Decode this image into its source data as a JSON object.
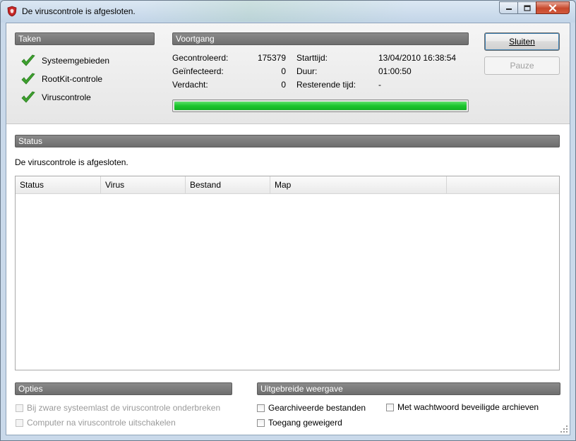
{
  "window": {
    "title": "De viruscontrole is afgesloten.",
    "icon": "shield-icon",
    "accent": "#c7492c"
  },
  "tasks": {
    "header": "Taken",
    "items": [
      {
        "label": "Systeemgebieden",
        "icon": "checkmark-icon"
      },
      {
        "label": "RootKit-controle",
        "icon": "checkmark-icon"
      },
      {
        "label": "Viruscontrole",
        "icon": "checkmark-icon"
      }
    ]
  },
  "progress": {
    "header": "Voortgang",
    "checked_label": "Gecontroleerd:",
    "checked_value": "175379",
    "infected_label": "Geïnfecteerd:",
    "infected_value": "0",
    "suspect_label": "Verdacht:",
    "suspect_value": "0",
    "start_label": "Starttijd:",
    "start_value": "13/04/2010 16:38:54",
    "duration_label": "Duur:",
    "duration_value": "01:00:50",
    "remaining_label": "Resterende tijd:",
    "remaining_value": "-",
    "percent": 100,
    "bar_color": "#1cc52e"
  },
  "buttons": {
    "close_label": "Sluiten",
    "pause_label": "Pauze"
  },
  "status": {
    "header": "Status",
    "message": "De viruscontrole is afgesloten.",
    "columns": [
      "Status",
      "Virus",
      "Bestand",
      "Map"
    ]
  },
  "options": {
    "header": "Opties",
    "pause_on_load": "Bij zware systeemlast de viruscontrole onderbreken",
    "shutdown_after": "Computer na viruscontrole uitschakelen"
  },
  "extended": {
    "header": "Uitgebreide weergave",
    "archived_files": "Gearchiveerde bestanden",
    "password_archives": "Met wachtwoord beveiligde archieven",
    "access_denied": "Toegang geweigerd"
  }
}
